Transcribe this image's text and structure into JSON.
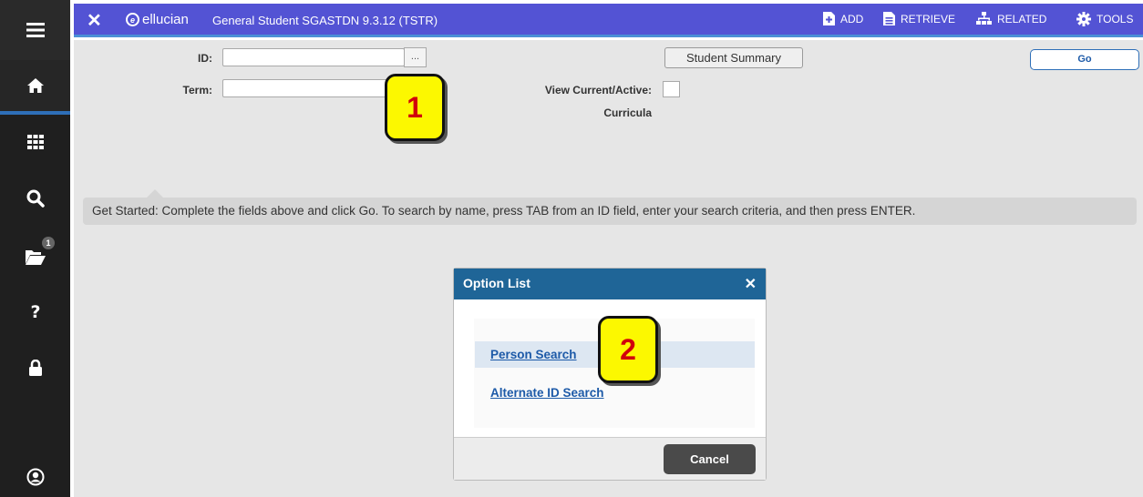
{
  "header": {
    "close_glyph": "✕",
    "logo_text": "ellucian",
    "title": "General Student SGASTDN 9.3.12 (TSTR)",
    "actions": [
      {
        "label": "ADD",
        "icon": "add-document-icon"
      },
      {
        "label": "RETRIEVE",
        "icon": "retrieve-document-icon"
      },
      {
        "label": "RELATED",
        "icon": "related-sitemap-icon"
      },
      {
        "label": "TOOLS",
        "icon": "gear-icon"
      }
    ]
  },
  "sidebar": {
    "items": [
      {
        "name": "menu",
        "icon": "hamburger-icon"
      },
      {
        "name": "home",
        "icon": "home-icon"
      },
      {
        "name": "applications",
        "icon": "grid-icon"
      },
      {
        "name": "search",
        "icon": "search-icon"
      },
      {
        "name": "recent",
        "icon": "folder-icon",
        "badge": "1"
      },
      {
        "name": "help",
        "icon": "question-icon"
      },
      {
        "name": "sign-out",
        "icon": "lock-icon"
      },
      {
        "name": "profile",
        "icon": "user-icon"
      }
    ]
  },
  "form": {
    "id_label": "ID:",
    "id_value": "",
    "lookup_glyph": "...",
    "term_label": "Term:",
    "term_value": "",
    "summary_button": "Student Summary",
    "view_current_label": "View Current/Active:",
    "curricula_label": "Curricula",
    "view_current_checked": false,
    "go_button": "Go",
    "info_message": "Get Started: Complete the fields above and click Go. To search by name, press TAB from an ID field, enter your search criteria, and then press ENTER."
  },
  "callouts": [
    "1",
    "2"
  ],
  "modal": {
    "title": "Option List",
    "close_glyph": "✕",
    "options": [
      "Person Search",
      "Alternate ID Search"
    ],
    "cancel_button": "Cancel"
  },
  "colors": {
    "header": "#5353d4",
    "sidebar": "#1f1f1f",
    "modal_header": "#1f6597",
    "callout_fill": "#fcf800",
    "callout_text": "#d1000b",
    "link": "#1d5aa8"
  }
}
